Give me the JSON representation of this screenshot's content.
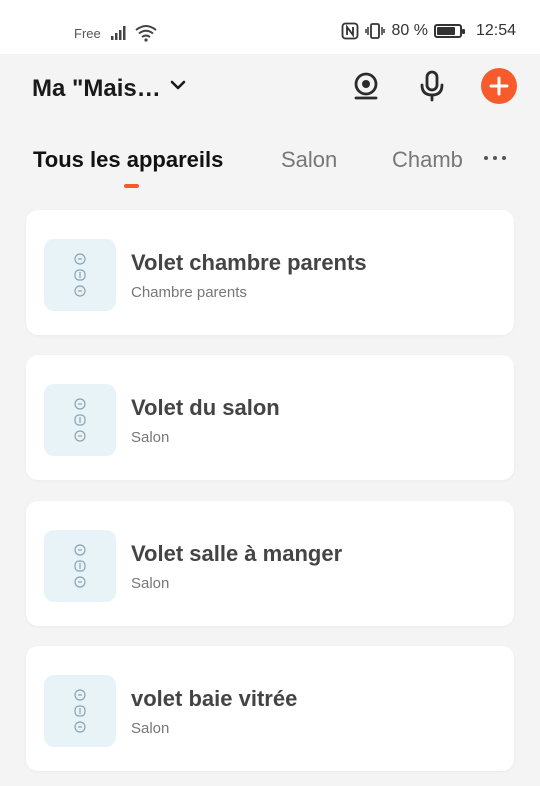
{
  "status_bar": {
    "carrier": "Free",
    "battery": "80 %",
    "battery_level": 0.8,
    "time": "12:54"
  },
  "header": {
    "home_name": "Ma \"Mais…",
    "icons": [
      "chevron-down-icon",
      "camera-icon",
      "microphone-icon",
      "add-icon"
    ],
    "accent_color": "#f75a2b"
  },
  "tabs": [
    {
      "label": "Tous les appareils",
      "active": true
    },
    {
      "label": "Salon",
      "active": false
    },
    {
      "label": "Chamb",
      "active": false
    }
  ],
  "devices": [
    {
      "name": "Volet chambre parents",
      "room": "Chambre parents",
      "icon": "shutter-icon"
    },
    {
      "name": "Volet du salon",
      "room": "Salon",
      "icon": "shutter-icon"
    },
    {
      "name": "Volet salle à manger",
      "room": "Salon",
      "icon": "shutter-icon"
    },
    {
      "name": "volet baie vitrée",
      "room": "Salon",
      "icon": "shutter-icon"
    }
  ]
}
